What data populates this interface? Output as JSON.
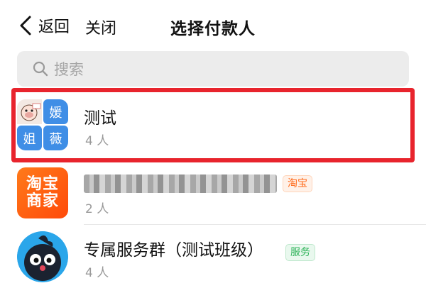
{
  "header": {
    "back_label": "返回",
    "close_label": "关闭",
    "title": "选择付款人"
  },
  "search": {
    "placeholder": "搜索"
  },
  "list": [
    {
      "name": "测试",
      "count": "4 人",
      "avatar_cells": [
        "",
        "媛",
        "姐",
        "薇"
      ]
    },
    {
      "name": "",
      "count": "2 人",
      "tag": "淘宝",
      "avatar_text": [
        "淘宝",
        "商家"
      ]
    },
    {
      "name": "专属服务群（测试班级）",
      "count": "4 人",
      "tag": "服务"
    }
  ],
  "colors": {
    "highlight": "#e8242d",
    "cell_blue": "#3f8ee6",
    "taobao_orange": "#ff5a0e",
    "service_green": "#2fb35a"
  }
}
